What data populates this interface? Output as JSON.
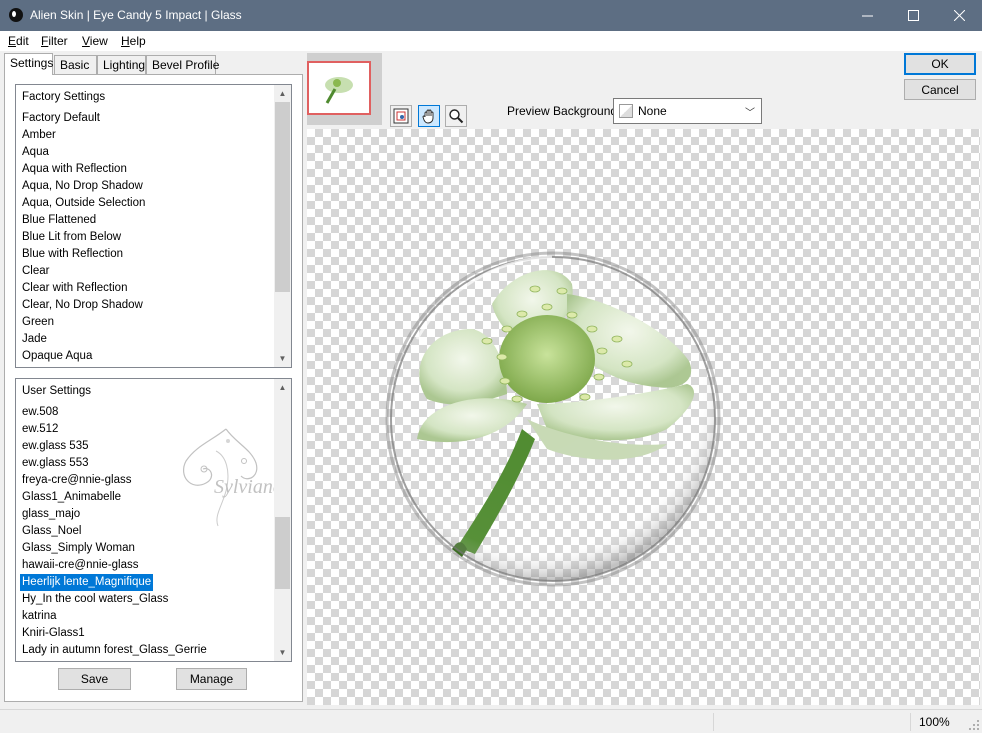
{
  "window": {
    "title": "Alien Skin | Eye Candy 5 Impact | Glass"
  },
  "menu": {
    "edit": {
      "hotkey": "E",
      "rest": "dit"
    },
    "filter": {
      "hotkey": "F",
      "rest": "ilter"
    },
    "view": {
      "hotkey": "V",
      "rest": "iew"
    },
    "help": {
      "hotkey": "H",
      "rest": "elp"
    }
  },
  "tabs": [
    "Settings",
    "Basic",
    "Lighting",
    "Bevel Profile"
  ],
  "factory_settings": {
    "header": "Factory Settings",
    "items": [
      "Factory Default",
      "Amber",
      "Aqua",
      "Aqua with Reflection",
      "Aqua, No Drop Shadow",
      "Aqua, Outside Selection",
      "Blue Flattened",
      "Blue Lit from Below",
      "Blue with Reflection",
      "Clear",
      "Clear with Reflection",
      "Clear, No Drop Shadow",
      "Green",
      "Jade",
      "Opaque Aqua"
    ]
  },
  "user_settings": {
    "header": "User Settings",
    "items": [
      "ew.508",
      "ew.512",
      "ew.glass 535",
      "ew.glass 553",
      "freya-cre@nnie-glass",
      "Glass1_Animabelle",
      "glass_majo",
      "Glass_Noel",
      "Glass_Simply Woman",
      "hawaii-cre@nnie-glass",
      "Heerlijk lente_Magnifique",
      "Hy_In the cool waters_Glass",
      "katrina",
      "Kniri-Glass1",
      "Lady in autumn forest_Glass_Gerrie"
    ],
    "selected": "Heerlijk lente_Magnifique"
  },
  "watermark_text": "Sylviane",
  "buttons": {
    "save": "Save",
    "manage": "Manage",
    "ok": "OK",
    "cancel": "Cancel"
  },
  "preview": {
    "background_label": "Preview Background:",
    "background_value": "None"
  },
  "status": {
    "zoom": "100%"
  },
  "colors": {
    "titlebar": "#5d6e83",
    "selection": "#0078d7",
    "thumbnail_border": "#e06060"
  },
  "icons": [
    "app-icon",
    "minimize-icon",
    "maximize-icon",
    "close-icon",
    "navigator-icon",
    "hand-icon",
    "zoom-icon"
  ]
}
